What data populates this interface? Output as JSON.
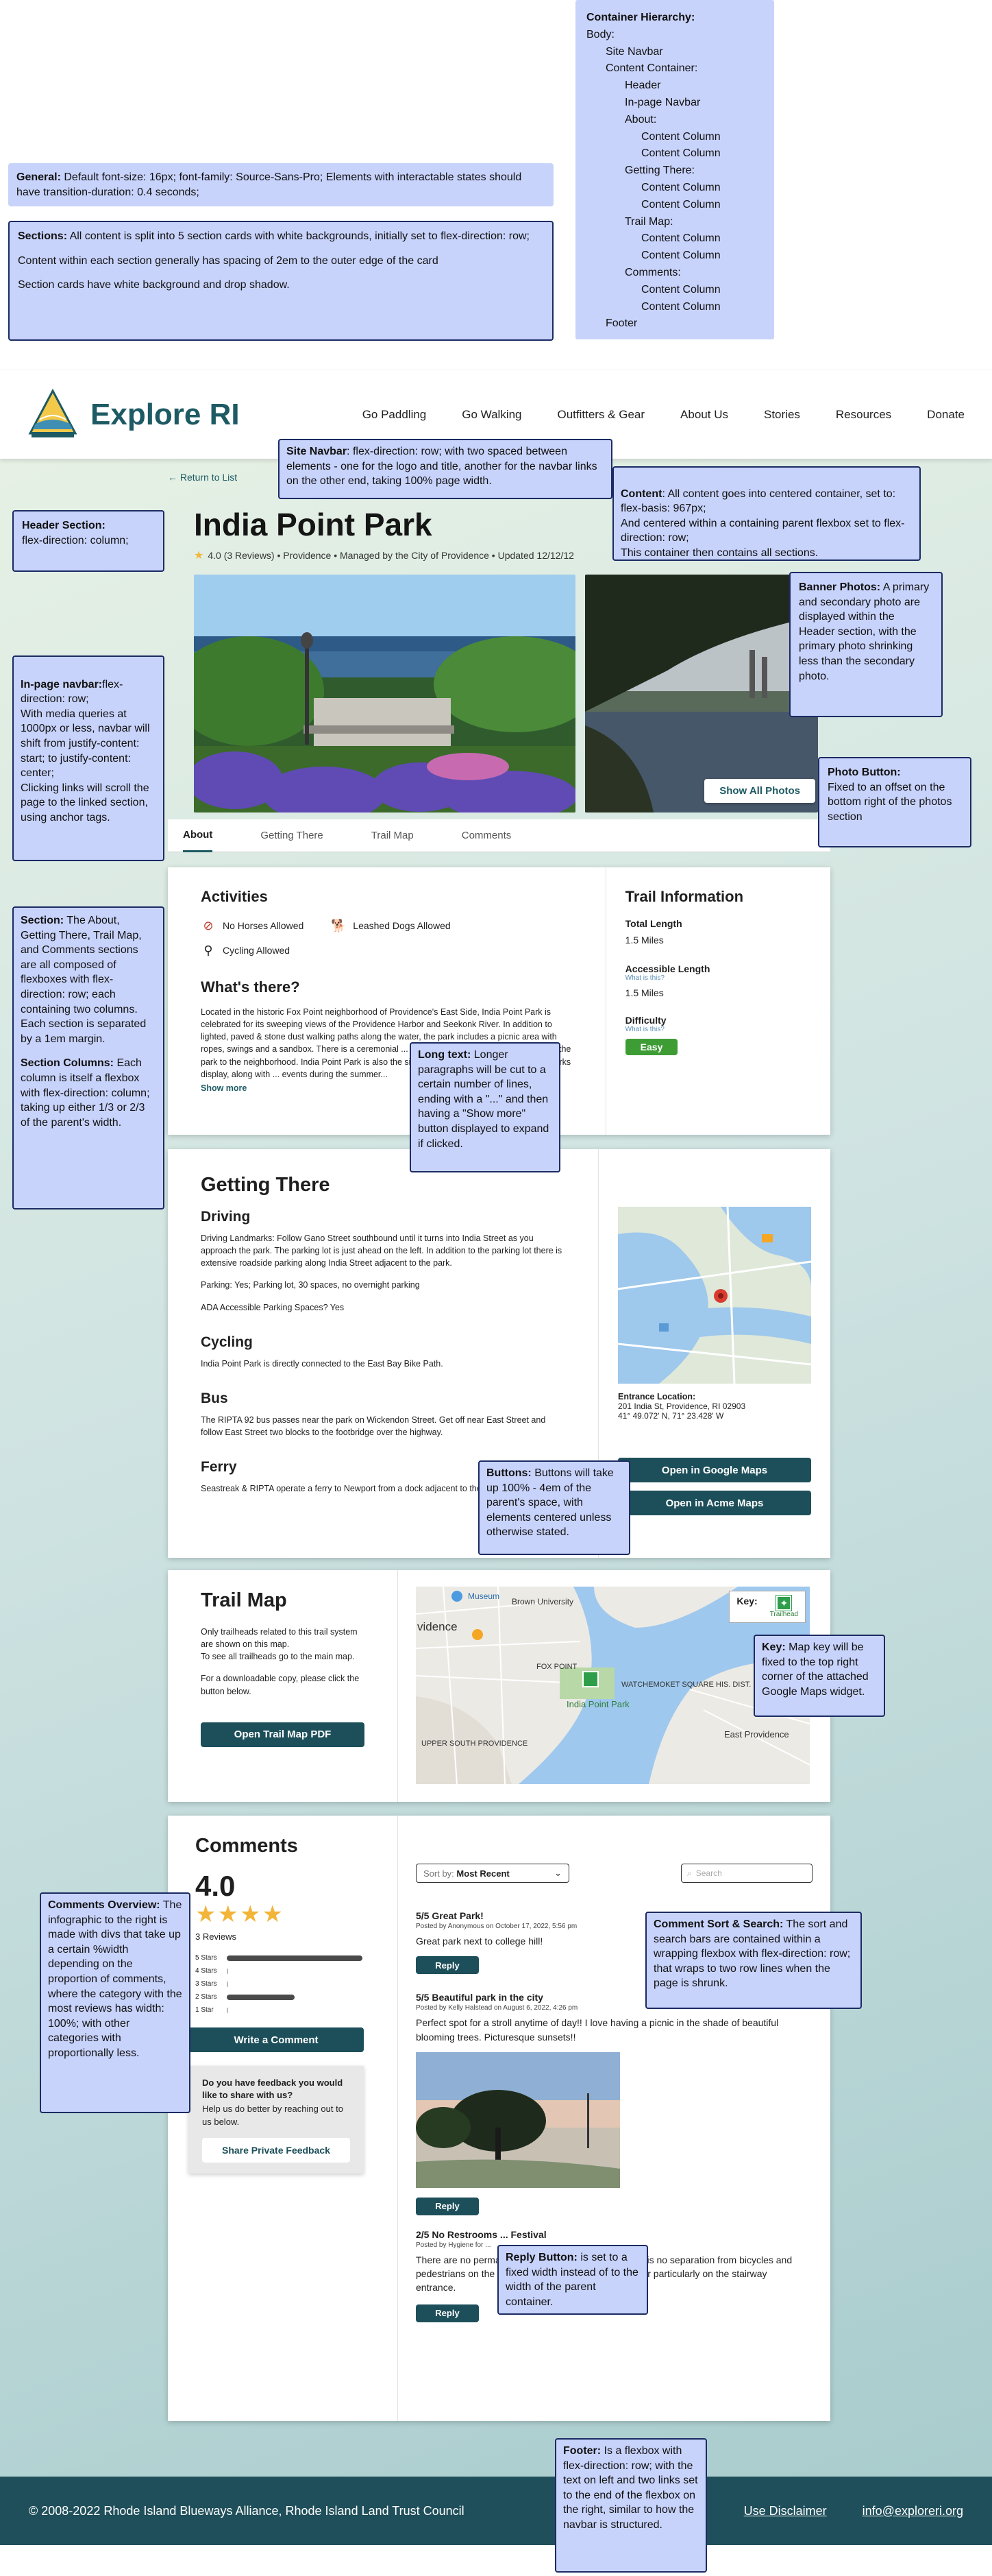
{
  "notes": {
    "hierarchy": [
      "Container Hierarchy:",
      "Body:",
      "Site Navbar",
      "Content Container:",
      "Header",
      "In-page Navbar",
      "About:",
      "Content Column",
      "Content Column",
      "Getting There:",
      "Content Column",
      "Content Column",
      "Trail Map:",
      "Content Column",
      "Content Column",
      "Comments:",
      "Content Column",
      "Content Column",
      "Footer"
    ],
    "general_label": "General:",
    "general_text": " Default font-size: 16px; font-family: Source-Sans-Pro; Elements with interactable states should have transition-duration: 0.4 seconds;",
    "sections_label": "Sections:",
    "sections_text1": " All content is split into 5 section cards with white backgrounds, initially set to flex-direction: row;",
    "sections_text2": "Content within each section generally has spacing of 2em to the outer edge of the card",
    "sections_text3": "Section cards have white background and drop shadow.",
    "navbar_label": "Site Navbar",
    "navbar_text": ": flex-direction: row; with two spaced between elements - one for the logo and title, another for the navbar links on the other end, taking 100% page width.",
    "content_label": "Content",
    "content_text": ": All content goes into centered container, set to: flex-basis: 967px;\nAnd centered within a containing parent flexbox set to flex-direction: row;\nThis container then contains all sections.",
    "header_label": "Header Section:",
    "header_text": "flex-direction: column;",
    "banner_label": "Banner Photos:",
    "banner_text": " A primary and secondary photo are displayed within the Header section, with the primary photo shrinking less than the secondary photo.",
    "inpage_label": "In-page navbar:",
    "inpage_text": "flex-direction: row;\nWith media queries at 1000px or less, navbar will shift from justify-content: start; to justify-content: center;\nClicking links will scroll the page to the linked section, using anchor tags.",
    "photobtn_label": "Photo Button:",
    "photobtn_text": "Fixed to an offset on the bottom right of the photos section",
    "section_label": "Section:",
    "section_text": " The About, Getting There, Trail Map, and Comments sections are all composed of flexboxes with flex-direction: row; each containing two columns. Each section is separated by a 1em margin.",
    "columns_label": "Section Columns:",
    "columns_text": " Each column is itself a flexbox with flex-direction: column; taking up either 1/3 or 2/3 of the parent's width.",
    "longtext_label": "Long text:",
    "longtext_text": " Longer paragraphs will be cut to a certain number of lines, ending with a \"...\" and then having a \"Show more\" button displayed to expand if clicked.",
    "buttons_label": "Buttons:",
    "buttons_text": " Buttons will take up 100% - 4em of the parent's space, with elements centered unless otherwise stated.",
    "key_label": "Key:",
    "key_text": " Map key will be fixed to the top right corner of the attached Google Maps widget.",
    "overview_label": "Comments Overview:",
    "overview_text": " The infographic to the right is made with divs that take up a certain %width depending on the proportion of comments, where the category with the most reviews has width: 100%; with other categories with proportionally less.",
    "sort_label": "Comment Sort & Search:",
    "sort_text": " The sort and search bars are contained within a wrapping flexbox with flex-direction: row; that wraps to two row lines when the page is shrunk.",
    "reply_label": "Reply Button:",
    "reply_text": " is set to a fixed width instead of to the width of the parent container.",
    "footer_label": "Footer:",
    "footer_text": " Is a flexbox with flex-direction: row; with the text on left and two links set to the end of the flexbox on the right, similar to how the navbar is structured."
  },
  "site": {
    "title": "Explore RI",
    "nav": [
      "Go Paddling",
      "Go Walking",
      "Outfitters & Gear",
      "About Us",
      "Stories",
      "Resources",
      "Donate"
    ]
  },
  "header": {
    "return": "← Return to List",
    "title": "India Point Park",
    "rating_line": "4.0 (3 Reviews) • Providence • Managed by the City of Providence • Updated 12/12/12",
    "photo_button": "Show All Photos"
  },
  "tabs": [
    "About",
    "Getting There",
    "Trail Map",
    "Comments"
  ],
  "about": {
    "activities_title": "Activities",
    "amenities": [
      "No Horses Allowed",
      "Leashed Dogs Allowed",
      "Cycling Allowed"
    ],
    "whats_there_title": "What's there?",
    "whats_there_text": "Located in the historic Fox Point neighborhood of Providence's East Side, India Point Park is celebrated for its sweeping views of the Providence Harbor and Seekonk River. In addition to lighted, paved & stone dust walking paths along the water, the park includes a picnic area with ropes, swings and a sandbox. There is a ceremonial ... connected across Rt. 195 - connecting the park to the neighborhood. India Point Park is also the site of the City's annual 4th of July fireworks display, along with ... events during the summer...",
    "show_more": "Show more",
    "info_title": "Trail Information",
    "total_length_label": "Total Length",
    "total_length": "1.5 Miles",
    "accessible_label": "Accessible Length",
    "what_is_this": "What is this?",
    "accessible_length": "1.5 Miles",
    "difficulty_label": "Difficulty",
    "difficulty": "Easy"
  },
  "getting_there": {
    "title": "Getting There",
    "driving_title": "Driving",
    "driving_text": "Driving Landmarks: Follow Gano Street southbound until it turns into India Street as you approach the park. The parking lot is just ahead on the left. In addition to the parking lot there is extensive roadside parking along India Street adjacent to the park.",
    "parking": "Parking: Yes; Parking lot, 30 spaces, no overnight parking",
    "ada": "ADA Accessible Parking Spaces? Yes",
    "cycling_title": "Cycling",
    "cycling_text": "India Point Park is directly connected to the East Bay Bike Path.",
    "bus_title": "Bus",
    "bus_text": "The RIPTA 92 bus passes near the park on Wickendon Street. Get off near East Street and follow East Street two blocks to the footbridge over the highway.",
    "ferry_title": "Ferry",
    "ferry_text": "Seastreak & RIPTA operate a ferry to Newport from a dock adjacent to the park.",
    "entrance_label": "Entrance Location:",
    "address": "201 India St, Providence, RI 02903",
    "coords": "41° 49.072' N,    71° 23.428' W",
    "google_btn": "Open in Google Maps",
    "acme_btn": "Open in Acme Maps"
  },
  "trail_map": {
    "title": "Trail Map",
    "text1": "Only trailheads related to this trail system are shown on this map.\nTo see all trailheads go to the main map.",
    "text2": "For a downloadable copy, please click the button below.",
    "button": "Open Trail Map PDF",
    "key_label": "Key:",
    "key_item": "Trailhead",
    "map_labels": [
      "Brown University",
      "FOX POINT",
      "WATCHEMOKET SQUARE HIS. DIST.",
      "India Point Park",
      "UPPER SOUTH PROVIDENCE",
      "East Providence",
      "vidence",
      "Museum"
    ]
  },
  "comments": {
    "title": "Comments",
    "score": "4.0",
    "reviews": "3 Reviews",
    "bars": [
      {
        "label": "5 Stars",
        "value": 1.0
      },
      {
        "label": "4 Stars",
        "value": 0
      },
      {
        "label": "3 Stars",
        "value": 0
      },
      {
        "label": "2 Stars",
        "value": 0.5
      },
      {
        "label": "1 Star",
        "value": 0
      }
    ],
    "write_btn": "Write a Comment",
    "feedback_q": "Do you have feedback you would like to share with us?",
    "feedback_sub": "Help us do better by reaching out to us below.",
    "feedback_btn": "Share Private Feedback",
    "sort_label": "Sort by:",
    "sort_value": "Most Recent",
    "search_placeholder": "Search",
    "reply": "Reply",
    "reviews_list": [
      {
        "title": "5/5 Great Park!",
        "by": "Posted by Anonymous on October 17, 2022, 5:56 pm",
        "body": "Great park next to college hill!"
      },
      {
        "title": "5/5 Beautiful park in the city",
        "by": "Posted by Kelly Halstead on August 6, 2022, 4:26 pm",
        "body": "Perfect spot for a stroll anytime of day!! I love having a picnic in the shade of beautiful blooming trees. Picturesque sunsets!!"
      },
      {
        "title": "2/5 No Restrooms ... Festival",
        "by": "Posted by Hygiene for ...",
        "body": "There are no permanent restrooms at this park. There is no separation from bicycles and pedestrians on the walkways. The cyclists are a danger particularly on the stairway entrance."
      }
    ]
  },
  "footer": {
    "copyright": "© 2008-2022 Rhode Island Blueways Alliance, Rhode Island Land Trust Council",
    "disclaimer": "Use Disclaimer",
    "email": "info@exploreri.org"
  },
  "colors": {
    "brand": "#1d5a63",
    "button": "#1d4f5a",
    "note_bg": "#c8d3fb",
    "easy": "#3e9c35",
    "star": "#f2b53a"
  }
}
